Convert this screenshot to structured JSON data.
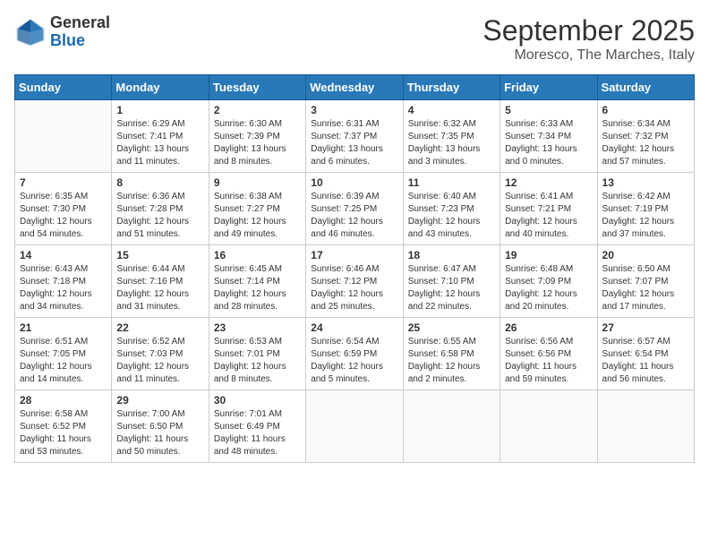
{
  "logo": {
    "general": "General",
    "blue": "Blue"
  },
  "title": "September 2025",
  "location": "Moresco, The Marches, Italy",
  "days_of_week": [
    "Sunday",
    "Monday",
    "Tuesday",
    "Wednesday",
    "Thursday",
    "Friday",
    "Saturday"
  ],
  "weeks": [
    [
      {
        "day": "",
        "sunrise": "",
        "sunset": "",
        "daylight": ""
      },
      {
        "day": "1",
        "sunrise": "Sunrise: 6:29 AM",
        "sunset": "Sunset: 7:41 PM",
        "daylight": "Daylight: 13 hours and 11 minutes."
      },
      {
        "day": "2",
        "sunrise": "Sunrise: 6:30 AM",
        "sunset": "Sunset: 7:39 PM",
        "daylight": "Daylight: 13 hours and 8 minutes."
      },
      {
        "day": "3",
        "sunrise": "Sunrise: 6:31 AM",
        "sunset": "Sunset: 7:37 PM",
        "daylight": "Daylight: 13 hours and 6 minutes."
      },
      {
        "day": "4",
        "sunrise": "Sunrise: 6:32 AM",
        "sunset": "Sunset: 7:35 PM",
        "daylight": "Daylight: 13 hours and 3 minutes."
      },
      {
        "day": "5",
        "sunrise": "Sunrise: 6:33 AM",
        "sunset": "Sunset: 7:34 PM",
        "daylight": "Daylight: 13 hours and 0 minutes."
      },
      {
        "day": "6",
        "sunrise": "Sunrise: 6:34 AM",
        "sunset": "Sunset: 7:32 PM",
        "daylight": "Daylight: 12 hours and 57 minutes."
      }
    ],
    [
      {
        "day": "7",
        "sunrise": "Sunrise: 6:35 AM",
        "sunset": "Sunset: 7:30 PM",
        "daylight": "Daylight: 12 hours and 54 minutes."
      },
      {
        "day": "8",
        "sunrise": "Sunrise: 6:36 AM",
        "sunset": "Sunset: 7:28 PM",
        "daylight": "Daylight: 12 hours and 51 minutes."
      },
      {
        "day": "9",
        "sunrise": "Sunrise: 6:38 AM",
        "sunset": "Sunset: 7:27 PM",
        "daylight": "Daylight: 12 hours and 49 minutes."
      },
      {
        "day": "10",
        "sunrise": "Sunrise: 6:39 AM",
        "sunset": "Sunset: 7:25 PM",
        "daylight": "Daylight: 12 hours and 46 minutes."
      },
      {
        "day": "11",
        "sunrise": "Sunrise: 6:40 AM",
        "sunset": "Sunset: 7:23 PM",
        "daylight": "Daylight: 12 hours and 43 minutes."
      },
      {
        "day": "12",
        "sunrise": "Sunrise: 6:41 AM",
        "sunset": "Sunset: 7:21 PM",
        "daylight": "Daylight: 12 hours and 40 minutes."
      },
      {
        "day": "13",
        "sunrise": "Sunrise: 6:42 AM",
        "sunset": "Sunset: 7:19 PM",
        "daylight": "Daylight: 12 hours and 37 minutes."
      }
    ],
    [
      {
        "day": "14",
        "sunrise": "Sunrise: 6:43 AM",
        "sunset": "Sunset: 7:18 PM",
        "daylight": "Daylight: 12 hours and 34 minutes."
      },
      {
        "day": "15",
        "sunrise": "Sunrise: 6:44 AM",
        "sunset": "Sunset: 7:16 PM",
        "daylight": "Daylight: 12 hours and 31 minutes."
      },
      {
        "day": "16",
        "sunrise": "Sunrise: 6:45 AM",
        "sunset": "Sunset: 7:14 PM",
        "daylight": "Daylight: 12 hours and 28 minutes."
      },
      {
        "day": "17",
        "sunrise": "Sunrise: 6:46 AM",
        "sunset": "Sunset: 7:12 PM",
        "daylight": "Daylight: 12 hours and 25 minutes."
      },
      {
        "day": "18",
        "sunrise": "Sunrise: 6:47 AM",
        "sunset": "Sunset: 7:10 PM",
        "daylight": "Daylight: 12 hours and 22 minutes."
      },
      {
        "day": "19",
        "sunrise": "Sunrise: 6:48 AM",
        "sunset": "Sunset: 7:09 PM",
        "daylight": "Daylight: 12 hours and 20 minutes."
      },
      {
        "day": "20",
        "sunrise": "Sunrise: 6:50 AM",
        "sunset": "Sunset: 7:07 PM",
        "daylight": "Daylight: 12 hours and 17 minutes."
      }
    ],
    [
      {
        "day": "21",
        "sunrise": "Sunrise: 6:51 AM",
        "sunset": "Sunset: 7:05 PM",
        "daylight": "Daylight: 12 hours and 14 minutes."
      },
      {
        "day": "22",
        "sunrise": "Sunrise: 6:52 AM",
        "sunset": "Sunset: 7:03 PM",
        "daylight": "Daylight: 12 hours and 11 minutes."
      },
      {
        "day": "23",
        "sunrise": "Sunrise: 6:53 AM",
        "sunset": "Sunset: 7:01 PM",
        "daylight": "Daylight: 12 hours and 8 minutes."
      },
      {
        "day": "24",
        "sunrise": "Sunrise: 6:54 AM",
        "sunset": "Sunset: 6:59 PM",
        "daylight": "Daylight: 12 hours and 5 minutes."
      },
      {
        "day": "25",
        "sunrise": "Sunrise: 6:55 AM",
        "sunset": "Sunset: 6:58 PM",
        "daylight": "Daylight: 12 hours and 2 minutes."
      },
      {
        "day": "26",
        "sunrise": "Sunrise: 6:56 AM",
        "sunset": "Sunset: 6:56 PM",
        "daylight": "Daylight: 11 hours and 59 minutes."
      },
      {
        "day": "27",
        "sunrise": "Sunrise: 6:57 AM",
        "sunset": "Sunset: 6:54 PM",
        "daylight": "Daylight: 11 hours and 56 minutes."
      }
    ],
    [
      {
        "day": "28",
        "sunrise": "Sunrise: 6:58 AM",
        "sunset": "Sunset: 6:52 PM",
        "daylight": "Daylight: 11 hours and 53 minutes."
      },
      {
        "day": "29",
        "sunrise": "Sunrise: 7:00 AM",
        "sunset": "Sunset: 6:50 PM",
        "daylight": "Daylight: 11 hours and 50 minutes."
      },
      {
        "day": "30",
        "sunrise": "Sunrise: 7:01 AM",
        "sunset": "Sunset: 6:49 PM",
        "daylight": "Daylight: 11 hours and 48 minutes."
      },
      {
        "day": "",
        "sunrise": "",
        "sunset": "",
        "daylight": ""
      },
      {
        "day": "",
        "sunrise": "",
        "sunset": "",
        "daylight": ""
      },
      {
        "day": "",
        "sunrise": "",
        "sunset": "",
        "daylight": ""
      },
      {
        "day": "",
        "sunrise": "",
        "sunset": "",
        "daylight": ""
      }
    ]
  ]
}
